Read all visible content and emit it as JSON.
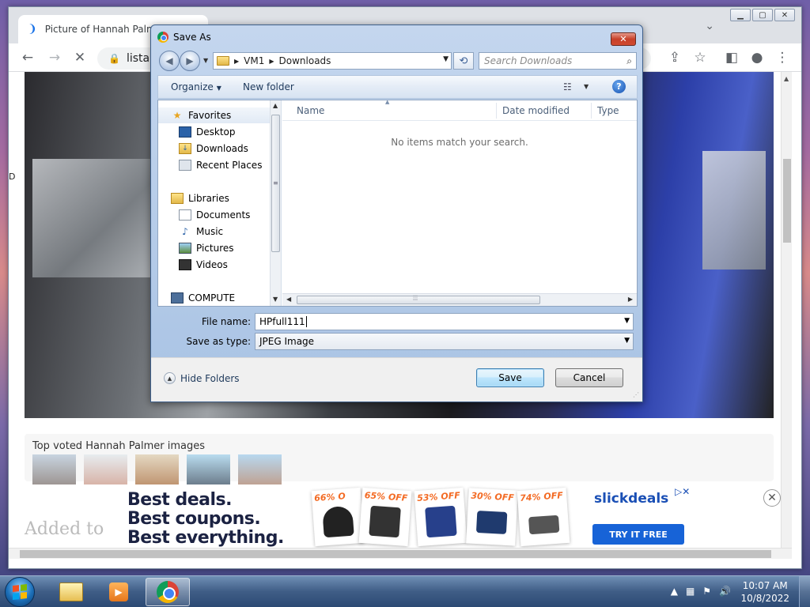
{
  "browser": {
    "tab_title": "Picture of Hannah Palmer",
    "url": "listal.c",
    "window_buttons": [
      "minimize",
      "maximize",
      "close"
    ]
  },
  "page": {
    "top_voted_title": "Top voted Hannah Palmer images",
    "added_to": "Added to",
    "ad": {
      "line1": "Best deals.",
      "line2": "Best coupons.",
      "line3": "Best everything.",
      "deals": [
        "66% O",
        "65% OFF",
        "53% OFF",
        "30% OFF",
        "74% OFF"
      ],
      "brand": "slickdeals",
      "cta": "TRY IT FREE"
    }
  },
  "dialog": {
    "title": "Save As",
    "breadcrumb": [
      "VM1",
      "Downloads"
    ],
    "search_placeholder": "Search Downloads",
    "organize_label": "Organize",
    "new_folder_label": "New folder",
    "nav_pane": {
      "favorites": "Favorites",
      "items_fav": [
        "Desktop",
        "Downloads",
        "Recent Places"
      ],
      "libraries": "Libraries",
      "items_lib": [
        "Documents",
        "Music",
        "Pictures",
        "Videos"
      ],
      "computer": "COMPUTE"
    },
    "columns": [
      "Name",
      "Date modified",
      "Type"
    ],
    "empty_message": "No items match your search.",
    "file_name_label": "File name:",
    "file_name_value": "HPfull111",
    "save_as_type_label": "Save as type:",
    "save_as_type_value": "JPEG Image",
    "hide_folders_label": "Hide Folders",
    "save_label": "Save",
    "cancel_label": "Cancel"
  },
  "taskbar": {
    "time": "10:07 AM",
    "date": "10/8/2022"
  }
}
